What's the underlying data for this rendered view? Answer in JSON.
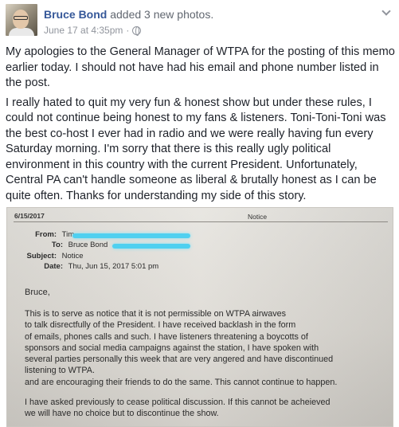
{
  "post": {
    "author": "Bruce Bond",
    "action": " added 3 new photos.",
    "timestamp": "June 17 at 4:35pm",
    "separator": "·",
    "paragraphs": [
      "My apologies to the General Manager of WTPA for the posting of this memo earlier today. I should not have had his email and phone number listed in the post.",
      "I really hated to quit my very fun & honest show but under these rules, I could not continue being honest to my fans & listeners. Toni-Toni-Toni was the best co-host I ever had in radio and we were really having fun every Saturday morning. I'm sorry that there is this really ugly political environment in this country with the current President. Unfortunately, Central PA can't handle someone as liberal & brutally honest as I can be quite often. Thanks for understanding my side of this story."
    ],
    "icons": {
      "privacy": "globe-icon",
      "menu": "chevron-down-icon"
    }
  },
  "memo": {
    "print_date": "6/15/2017",
    "print_title": "Notice",
    "from_label": "From:",
    "from_value": "Tim",
    "to_label": "To:",
    "to_value": "Bruce Bond",
    "subject_label": "Subject:",
    "subject_value": "Notice",
    "date_label": "Date:",
    "date_value": "Thu, Jun 15, 2017 5:01 pm",
    "greeting": "Bruce,",
    "body_lines": [
      "This is to serve as notice that it is not permissible on WTPA airwaves",
      "to talk disrectfully of the President.  I have received backlash in the form",
      "of emails, phones calls and such.  I have listeners threatening a boycotts of",
      "sponsors and social media campaigns against the station, I have spoken with",
      "several parties personally this week that are very angered and have discontinued",
      "listening to WTPA.",
      "and are encouraging their friends to do the same.  This cannot continue to happen."
    ],
    "closing_lines": [
      "I have asked previously to cease political discussion.  If this cannot be acheieved",
      "we will have no choice but to discontinue the show."
    ],
    "redaction_color": "#4fd0f0"
  }
}
